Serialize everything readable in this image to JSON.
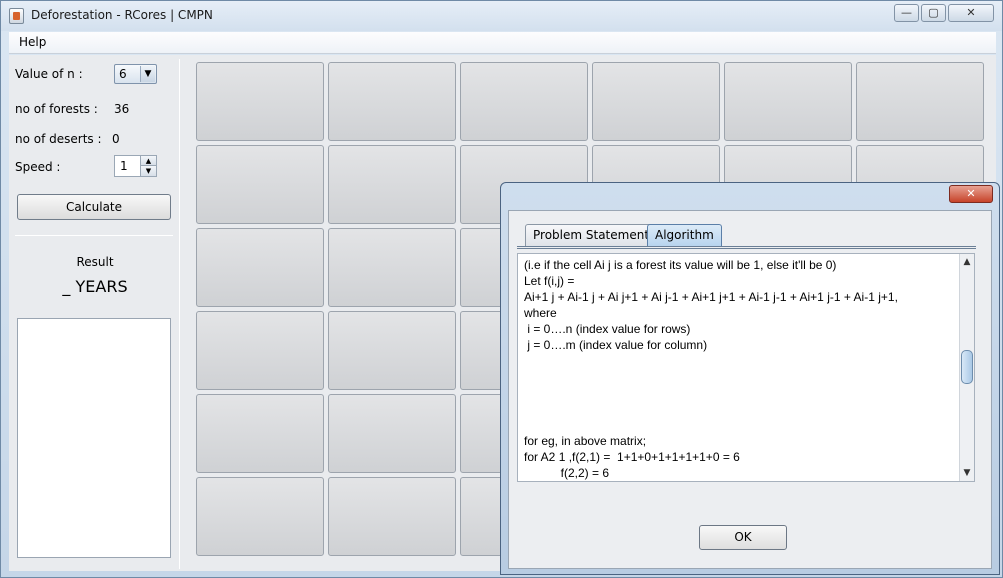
{
  "window": {
    "title": "Deforestation - RCores | CMPN",
    "minimize": "—",
    "maximize": "▢",
    "close": "✕"
  },
  "menu": {
    "help": "Help"
  },
  "controls": {
    "n_label": "Value of n :",
    "n_value": "6",
    "forests_label": "no of forests :",
    "forests_value": "36",
    "deserts_label": "no of deserts :",
    "deserts_value": "0",
    "speed_label": "Speed :",
    "speed_value": "1",
    "calculate": "Calculate",
    "result_label": "Result",
    "result_value": "_ YEARS",
    "result_text": ""
  },
  "grid": {
    "rows": 6,
    "cols": 6
  },
  "dialog": {
    "close": "✕",
    "tabs": [
      {
        "label": "Problem Statement",
        "active": false
      },
      {
        "label": "Algorithm",
        "active": true
      }
    ],
    "lines": [
      "(i.e if the cell Ai j is a forest its value will be 1, else it'll be 0)",
      "Let f(i,j) =",
      "Ai+1 j + Ai-1 j + Ai j+1 + Ai j-1 + Ai+1 j+1 + Ai-1 j-1 + Ai+1 j-1 + Ai-1 j+1,",
      "where",
      " i = 0….n (index value for rows)",
      " j = 0….m (index value for column)",
      "",
      "",
      "",
      "",
      "",
      "for eg, in above matrix;",
      "for A2 1 ,f(2,1) =  1+1+0+1+1+1+1+0 = 6",
      "           f(2,2) = 6"
    ],
    "ok": "OK"
  }
}
